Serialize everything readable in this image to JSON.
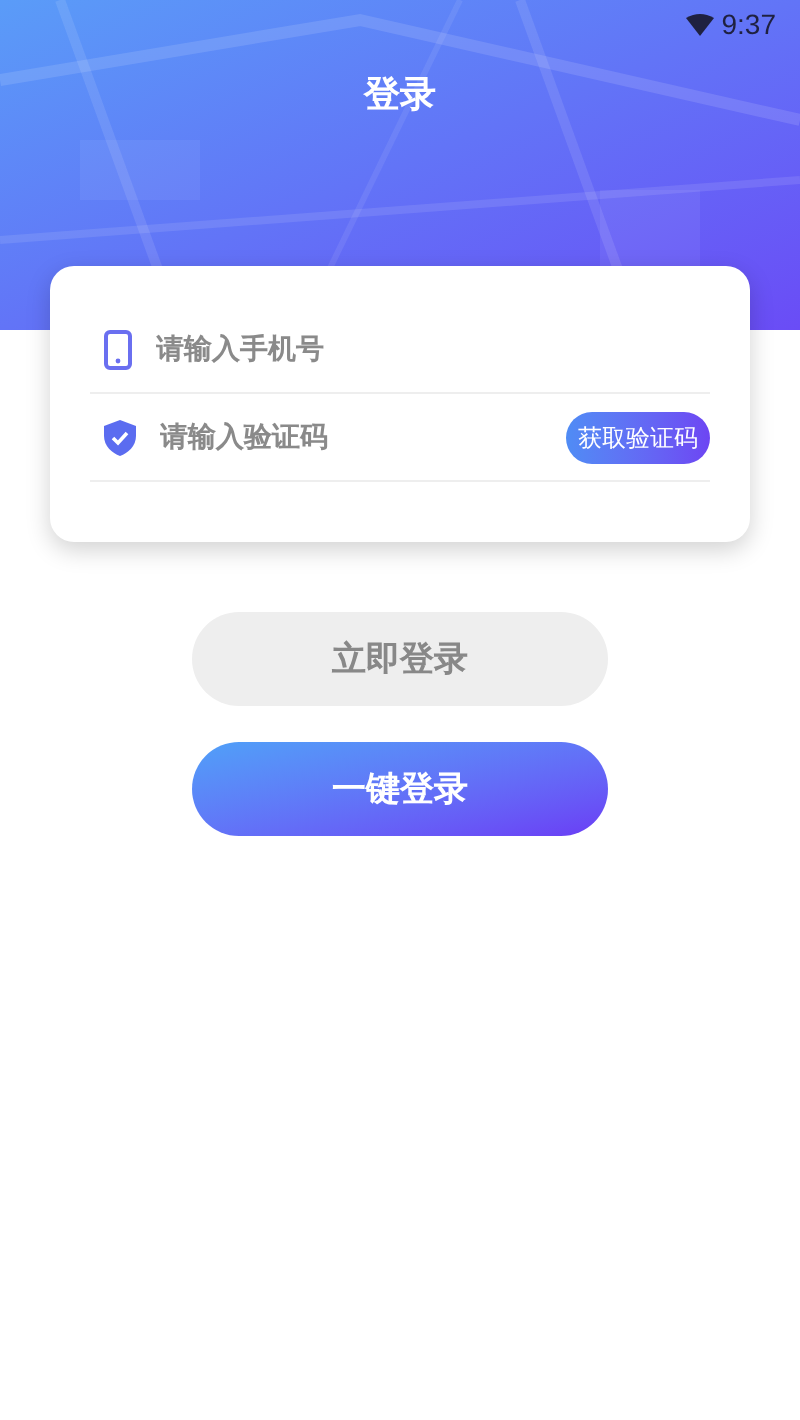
{
  "status_bar": {
    "time": "9:37"
  },
  "header": {
    "title": "登录"
  },
  "form": {
    "fields": [
      {
        "kind": "phone",
        "placeholder": "请输入手机号"
      },
      {
        "kind": "code",
        "placeholder": "请输入验证码",
        "action": "获取验证码"
      }
    ]
  },
  "buttons": [
    {
      "kind": "plain",
      "label": "立即登录",
      "disabled": true
    },
    {
      "kind": "gradient",
      "label": "一键登录",
      "disabled": false
    }
  ]
}
